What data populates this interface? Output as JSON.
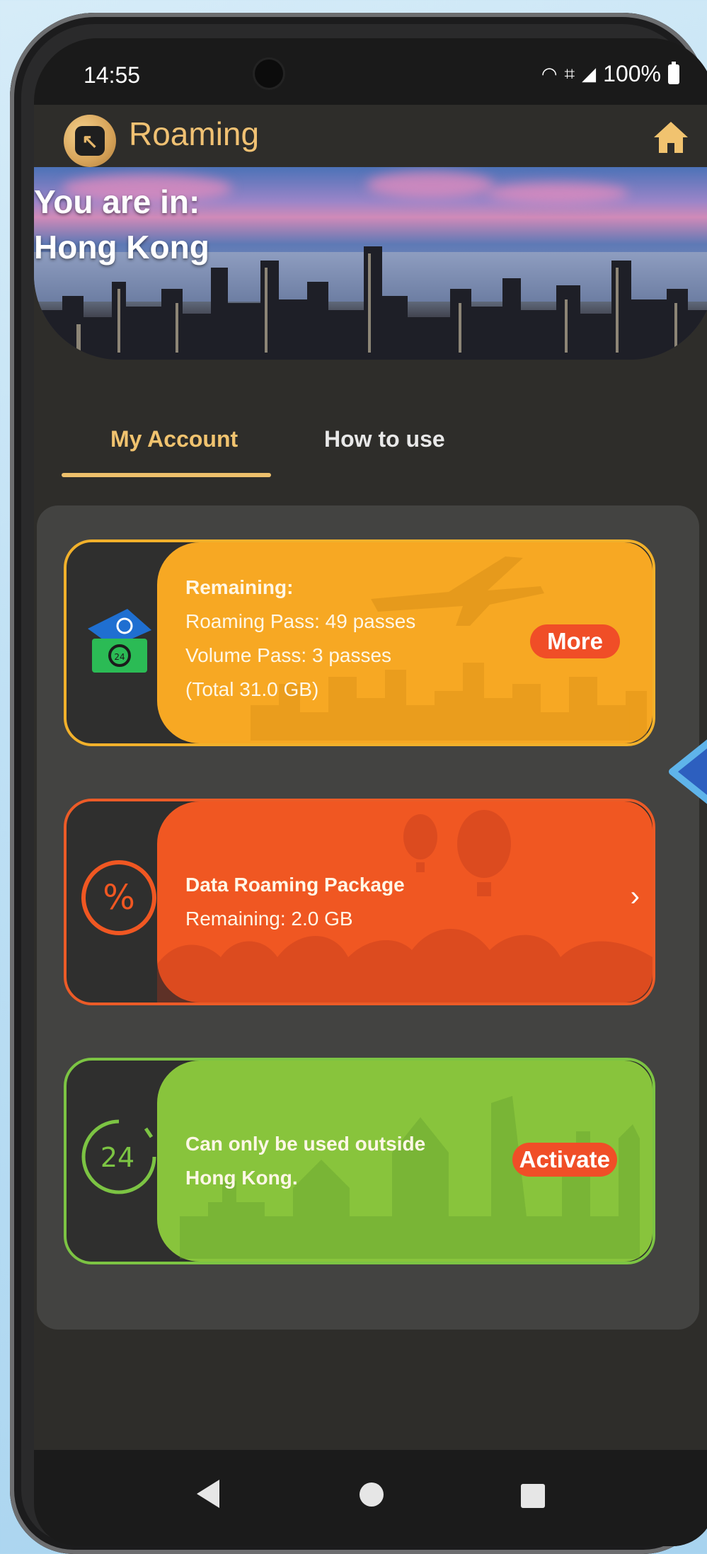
{
  "status_bar": {
    "time": "14:55",
    "battery": "100%",
    "icons": [
      "nfc-icon",
      "volte-icon",
      "signal-icon",
      "battery-icon"
    ]
  },
  "app_bar": {
    "title": "Roaming",
    "back_icon": "back-arrow-icon",
    "home_icon": "home-icon"
  },
  "banner": {
    "line1": "You are in:",
    "line2": "Hong Kong"
  },
  "tabs": [
    {
      "label": "My Account",
      "active": true
    },
    {
      "label": "How to use",
      "active": false
    }
  ],
  "cards": [
    {
      "id": "roaming-pass",
      "title": "Remaining:",
      "lines": [
        "Roaming Pass: 49 passes",
        "Volume Pass: 3 passes",
        "(Total 31.0 GB)"
      ],
      "action": "More",
      "color": "#f7a823"
    },
    {
      "id": "data-roaming-package",
      "title": "Data Roaming Package",
      "lines": [
        "Remaining: 2.0 GB"
      ],
      "action": "",
      "color": "#f05722"
    },
    {
      "id": "day-pass",
      "title": "",
      "lines": [
        "Can only be used outside",
        "Hong Kong."
      ],
      "action": "Activate",
      "icon_text": "24",
      "color": "#88c43c"
    }
  ],
  "colors": {
    "accent": "#f1c36f",
    "pointer": "#2d5fbf"
  }
}
